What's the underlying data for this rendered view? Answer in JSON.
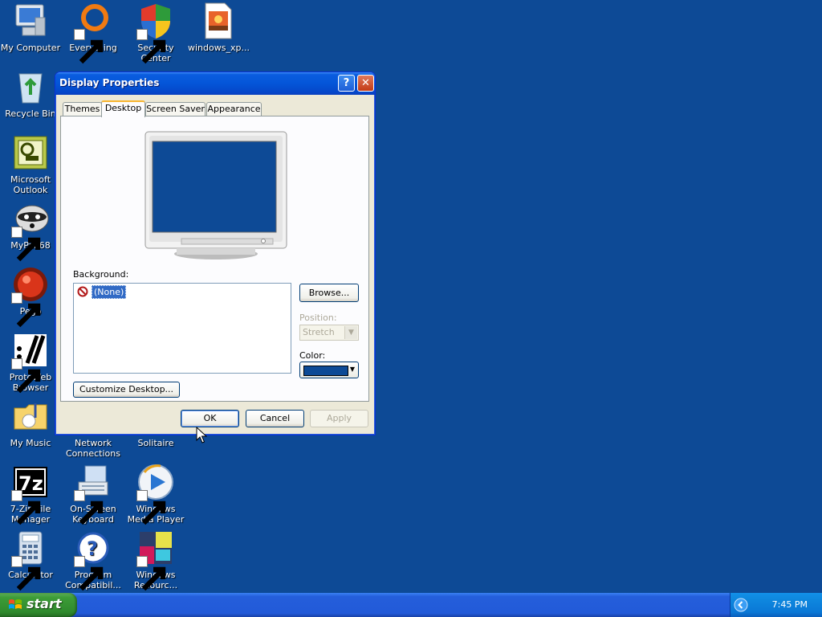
{
  "desktop": {
    "background_color": "#0d4a96",
    "icons": [
      {
        "label": "My Computer",
        "icon": "my-computer-icon",
        "shortcut": false
      },
      {
        "label": "Everything",
        "icon": "everything-search-icon",
        "shortcut": true
      },
      {
        "label": "Security Center",
        "icon": "security-center-shield-icon",
        "shortcut": true
      },
      {
        "label": "windows_xp...",
        "icon": "image-file-icon",
        "shortcut": false
      },
      {
        "label": "Recycle Bin",
        "icon": "recycle-bin-icon",
        "shortcut": false
      },
      {
        "label": "Microsoft Outlook",
        "icon": "outlook-icon",
        "shortcut": false
      },
      {
        "label": "MyPal 68",
        "icon": "mypal-raccoon-icon",
        "shortcut": true
      },
      {
        "label": "Pego",
        "icon": "pego-icon",
        "shortcut": true
      },
      {
        "label": "ProtoWeb Browser",
        "icon": "protoweb-icon",
        "shortcut": true
      },
      {
        "label": "My Music",
        "icon": "music-folder-icon",
        "shortcut": false
      },
      {
        "label": "Network Connections",
        "icon": "network-connections-icon",
        "shortcut": false
      },
      {
        "label": "Solitaire",
        "icon": "solitaire-icon",
        "shortcut": false
      },
      {
        "label": "7-Zip File Manager",
        "icon": "7zip-icon",
        "shortcut": true
      },
      {
        "label": "On-Screen Keyboard",
        "icon": "keyboard-icon",
        "shortcut": true
      },
      {
        "label": "Windows Media Player",
        "icon": "media-player-icon",
        "shortcut": true
      },
      {
        "label": "Calculator",
        "icon": "calculator-icon",
        "shortcut": true
      },
      {
        "label": "Program Compatibil...",
        "icon": "help-question-icon",
        "shortcut": true
      },
      {
        "label": "Windows Resourc...",
        "icon": "windows-resource-kit-icon",
        "shortcut": true
      }
    ]
  },
  "dialog": {
    "title": "Display Properties",
    "help_glyph": "?",
    "close_glyph": "✕",
    "tabs": [
      {
        "label": "Themes",
        "active": false
      },
      {
        "label": "Desktop",
        "active": true
      },
      {
        "label": "Screen Saver",
        "active": false
      },
      {
        "label": "Appearance",
        "active": false
      }
    ],
    "background_label": "Background:",
    "background_items": [
      {
        "label": "(None)",
        "selected": true
      }
    ],
    "browse_button": "Browse...",
    "position_label": "Position:",
    "position_value": "Stretch",
    "color_label": "Color:",
    "color_value": "#0d4a96",
    "customize_button": "Customize Desktop...",
    "ok_button": "OK",
    "cancel_button": "Cancel",
    "apply_button": "Apply"
  },
  "taskbar": {
    "start_label": "start",
    "clock": "7:45 PM"
  }
}
